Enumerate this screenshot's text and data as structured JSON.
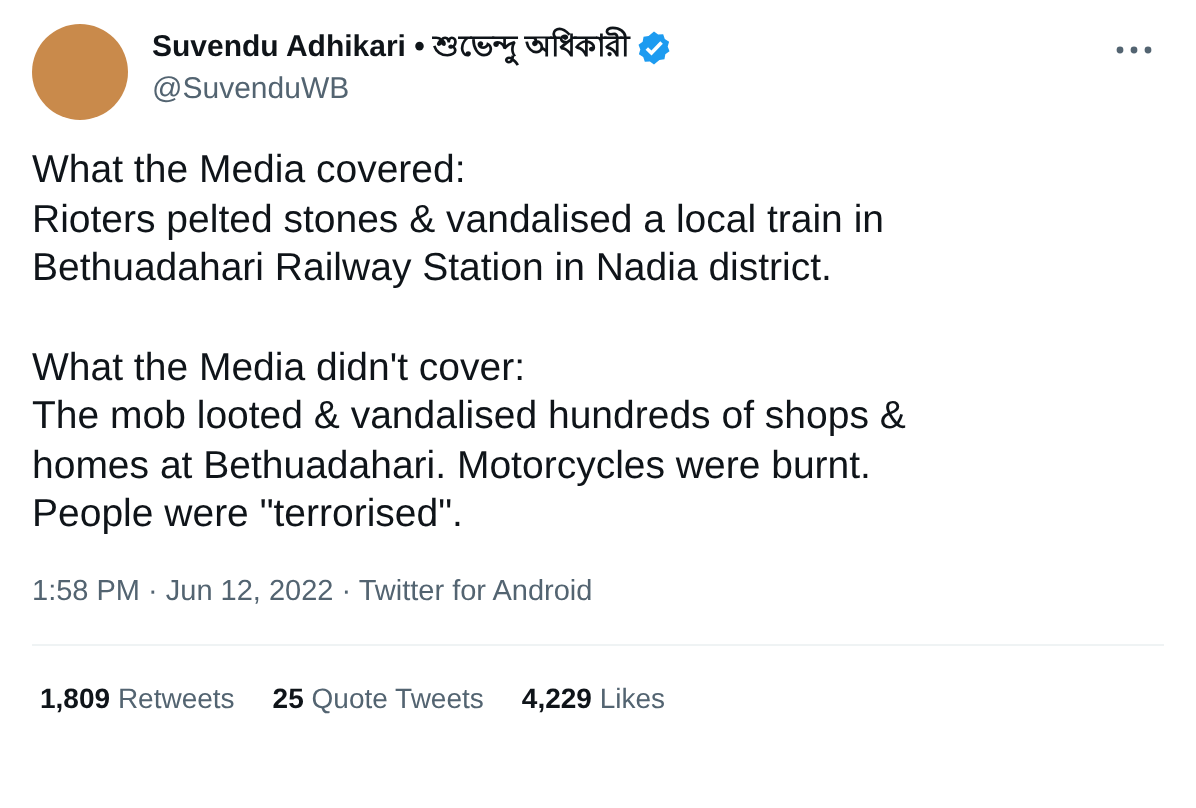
{
  "author": {
    "name": "Suvendu Adhikari • শুভেন্দু অধিকারী",
    "verified": true,
    "handle": "@SuvenduWB"
  },
  "body": [
    "What the Media covered:\nRioters pelted stones & vandalised a local train in\nBethuadahari Railway Station in Nadia district.",
    "What the Media didn't cover:\nThe mob looted & vandalised hundreds of shops &\nhomes at Bethuadahari. Motorcycles were burnt.\nPeople were \"terrorised\"."
  ],
  "meta": "1:58 PM · Jun 12, 2022 · Twitter for Android",
  "stats": [
    {
      "count": "1,809",
      "label": "Retweets"
    },
    {
      "count": "25",
      "label": "Quote Tweets"
    },
    {
      "count": "4,229",
      "label": "Likes"
    }
  ]
}
